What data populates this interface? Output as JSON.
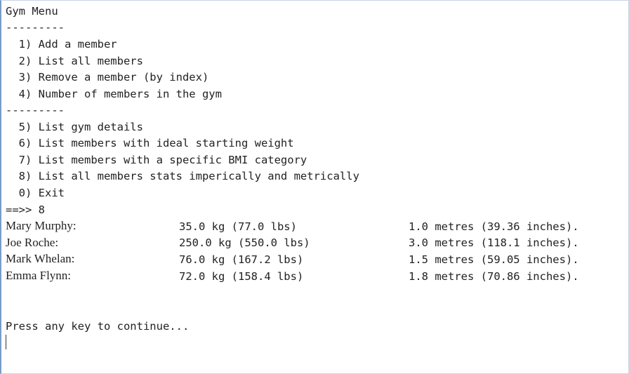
{
  "menu": {
    "title": "Gym Menu",
    "divider": "---------",
    "items": [
      "  1) Add a member",
      "  2) List all members",
      "  3) Remove a member (by index)",
      "  4) Number of members in the gym"
    ],
    "divider2": "---------",
    "items2": [
      "  5) List gym details",
      "  6) List members with ideal starting weight",
      "  7) List members with a specific BMI category",
      "  8) List all members stats imperically and metrically",
      "  0) Exit"
    ],
    "prompt": "==>> 8"
  },
  "members": [
    {
      "name": "Mary Murphy:",
      "weight": "35.0 kg (77.0 lbs)",
      "height": "1.0 metres (39.36 inches)."
    },
    {
      "name": "Joe Roche:",
      "weight": "250.0 kg (550.0 lbs)",
      "height": "3.0 metres (118.1 inches)."
    },
    {
      "name": "Mark Whelan:",
      "weight": "76.0 kg (167.2 lbs)",
      "height": "1.5 metres (59.05 inches)."
    },
    {
      "name": "Emma Flynn:",
      "weight": "72.0 kg (158.4 lbs)",
      "height": "1.8 metres (70.86 inches)."
    }
  ],
  "continue_prompt": "Press any key to continue..."
}
